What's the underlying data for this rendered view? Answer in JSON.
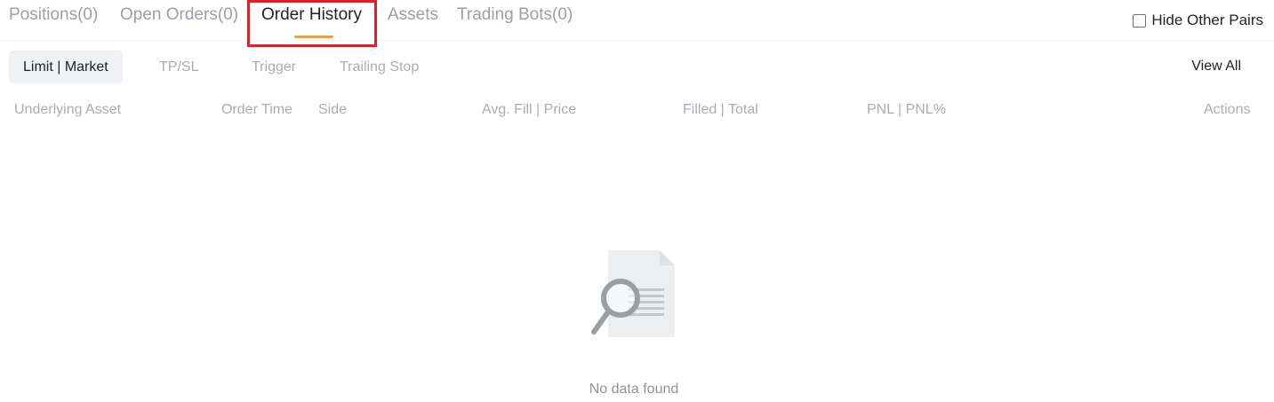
{
  "tabs": {
    "positions": "Positions(0)",
    "open_orders": "Open Orders(0)",
    "order_history": "Order History",
    "assets": "Assets",
    "trading_bots": "Trading Bots(0)"
  },
  "hide_other_pairs": {
    "label": "Hide Other Pairs",
    "checked": false
  },
  "sub_tabs": {
    "limit_market": "Limit | Market",
    "tp_sl": "TP/SL",
    "trigger": "Trigger",
    "trailing_stop": "Trailing Stop"
  },
  "view_all": "View All",
  "columns": {
    "underlying_asset": "Underlying Asset",
    "order_time": "Order Time",
    "side": "Side",
    "avg_fill_price": "Avg. Fill | Price",
    "filled_total": "Filled | Total",
    "pnl": "PNL | PNL%",
    "actions": "Actions"
  },
  "empty_state": {
    "message": "No data found",
    "icon": "document-search-icon"
  },
  "colors": {
    "active_tab_underline": "#f0a23a",
    "highlight_box": "#e21d2a",
    "inactive_text": "#a9adb3",
    "active_text": "#1e2329"
  }
}
